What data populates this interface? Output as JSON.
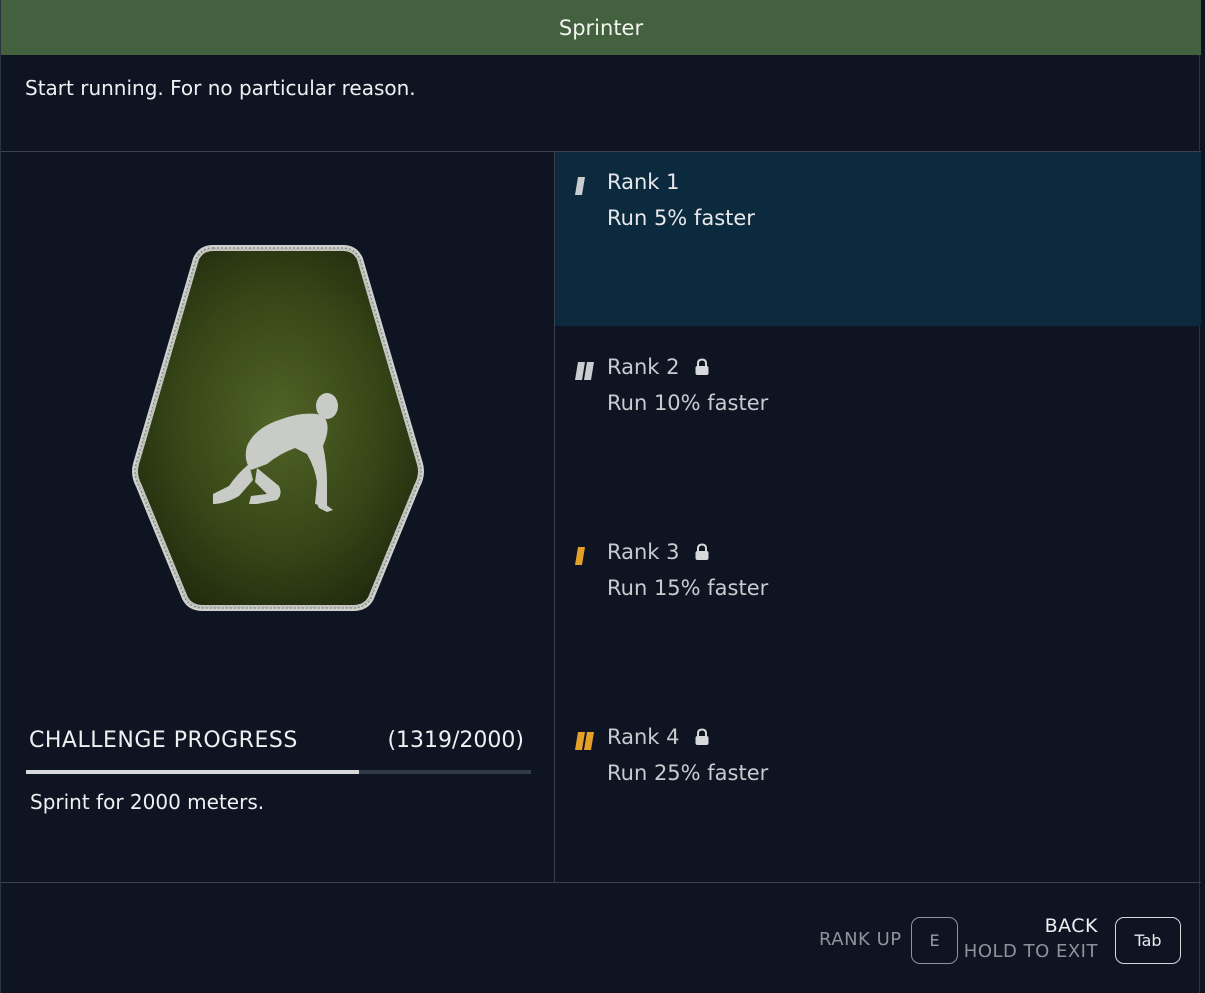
{
  "title": "Sprinter",
  "description": "Start running. For no particular reason.",
  "challenge": {
    "label": "CHALLENGE PROGRESS",
    "count_text": "(1319/2000)",
    "current": 1319,
    "target": 2000,
    "description": "Sprint for 2000 meters."
  },
  "badge": {
    "icon": "sprinter-crouch-icon",
    "fill_color": "#3e4e1c",
    "border_color": "#c9cbc8"
  },
  "ranks": [
    {
      "name": "Rank 1",
      "desc": "Run 5% faster",
      "locked": false,
      "selected": true,
      "tier_color": "#c9ccd1",
      "bars": 1
    },
    {
      "name": "Rank 2",
      "desc": "Run 10% faster",
      "locked": true,
      "selected": false,
      "tier_color": "#c9ccd1",
      "bars": 2
    },
    {
      "name": "Rank 3",
      "desc": "Run 15% faster",
      "locked": true,
      "selected": false,
      "tier_color": "#e5a02a",
      "bars": 1
    },
    {
      "name": "Rank 4",
      "desc": "Run 25% faster",
      "locked": true,
      "selected": false,
      "tier_color": "#e5a02a",
      "bars": 2
    }
  ],
  "footer": {
    "rank_up_label": "RANK UP",
    "rank_up_key": "E",
    "back_label": "BACK",
    "hold_label": "HOLD TO EXIT",
    "back_key": "Tab"
  },
  "colors": {
    "title_bar": "#44613f",
    "background": "#0e1421",
    "selected_rank": "#0b2a3e",
    "progress_fill": "#d7d9dc"
  }
}
